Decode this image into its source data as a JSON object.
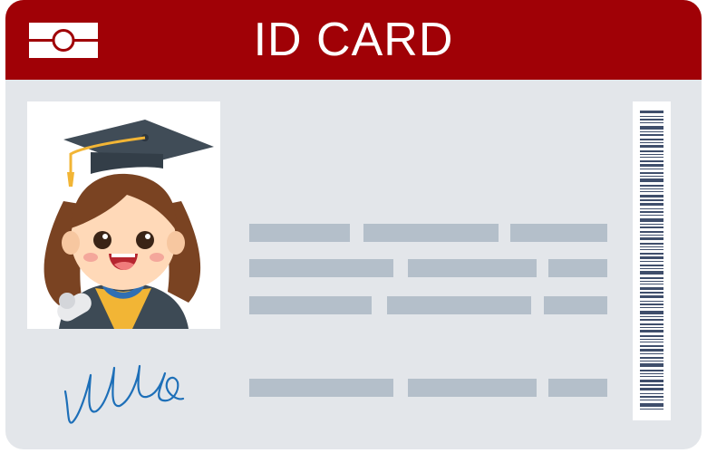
{
  "header": {
    "title": "ID CARD"
  },
  "icons": {
    "chip": "card-chip-icon",
    "portrait": "graduate-portrait",
    "signature": "signature-scribble",
    "barcode": "barcode"
  },
  "colors": {
    "header": "#a00106",
    "card": "#e3e6ea",
    "placeholder": "#b4bfca",
    "barcode": "#3f4e6b",
    "signature": "#1d6fb8"
  },
  "info_rows": [
    {
      "segments": 3
    },
    {
      "segments": 3
    },
    {
      "segments": 3
    },
    {
      "segments": 3
    }
  ]
}
